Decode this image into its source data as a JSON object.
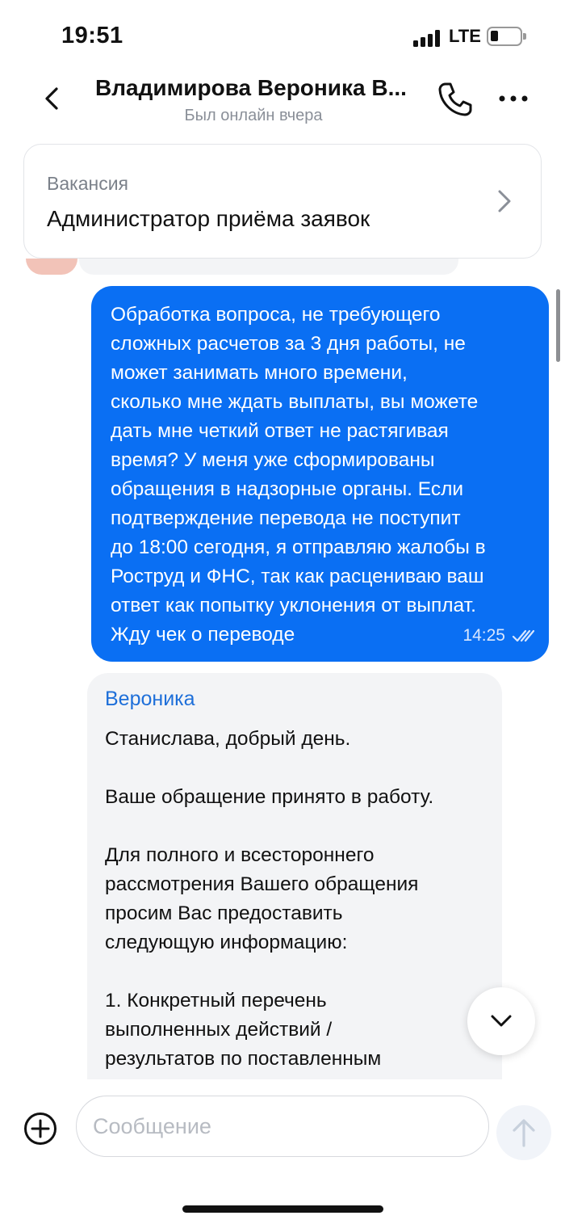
{
  "status_bar": {
    "time": "19:51",
    "network": "LTE"
  },
  "header": {
    "contact_name": "Владимирова Вероника В...",
    "contact_status": "Был онлайн вчера",
    "icons": [
      "chevron-left-icon",
      "phone-icon",
      "more-horizontal-icon"
    ]
  },
  "vacancy": {
    "label": "Вакансия",
    "title": "Администратор приёма заявок"
  },
  "messages": [
    {
      "direction": "outgoing",
      "text": "Обработка вопроса, не требующего\nсложных расчетов за 3 дня работы, не\nможет занимать много времени,\nсколько мне ждать выплаты, вы можете\nдать мне четкий ответ не растягивая\nвремя? У меня уже сформированы\nобращения в надзорные органы. Если\nподтверждение перевода не поступит\nдо 18:00 сегодня, я отправляю жалобы в\nРоструд и ФНС, так как расцениваю ваш\nответ как попытку уклонения от выплат.\nЖду чек о переводе",
      "time": "14:25",
      "status": "read"
    },
    {
      "direction": "incoming",
      "sender": "Вероника",
      "text": "Станислава, добрый день.\n\nВаше обращение принято в работу.\n\nДля полного и всестороннего\nрассмотрения Вашего обращения\nпросим Вас предоставить\nследующую информацию:\n\n1. Конкретный перечень\nвыполненных действий /\nрезультатов по поставленным\nзадачам. Включая: ссылки/"
    }
  ],
  "composer": {
    "placeholder": "Сообщение"
  },
  "colors": {
    "outgoing_bubble": "#0a6ff3",
    "incoming_bubble": "#f3f4f6",
    "sender_name": "#1e6fd9"
  }
}
